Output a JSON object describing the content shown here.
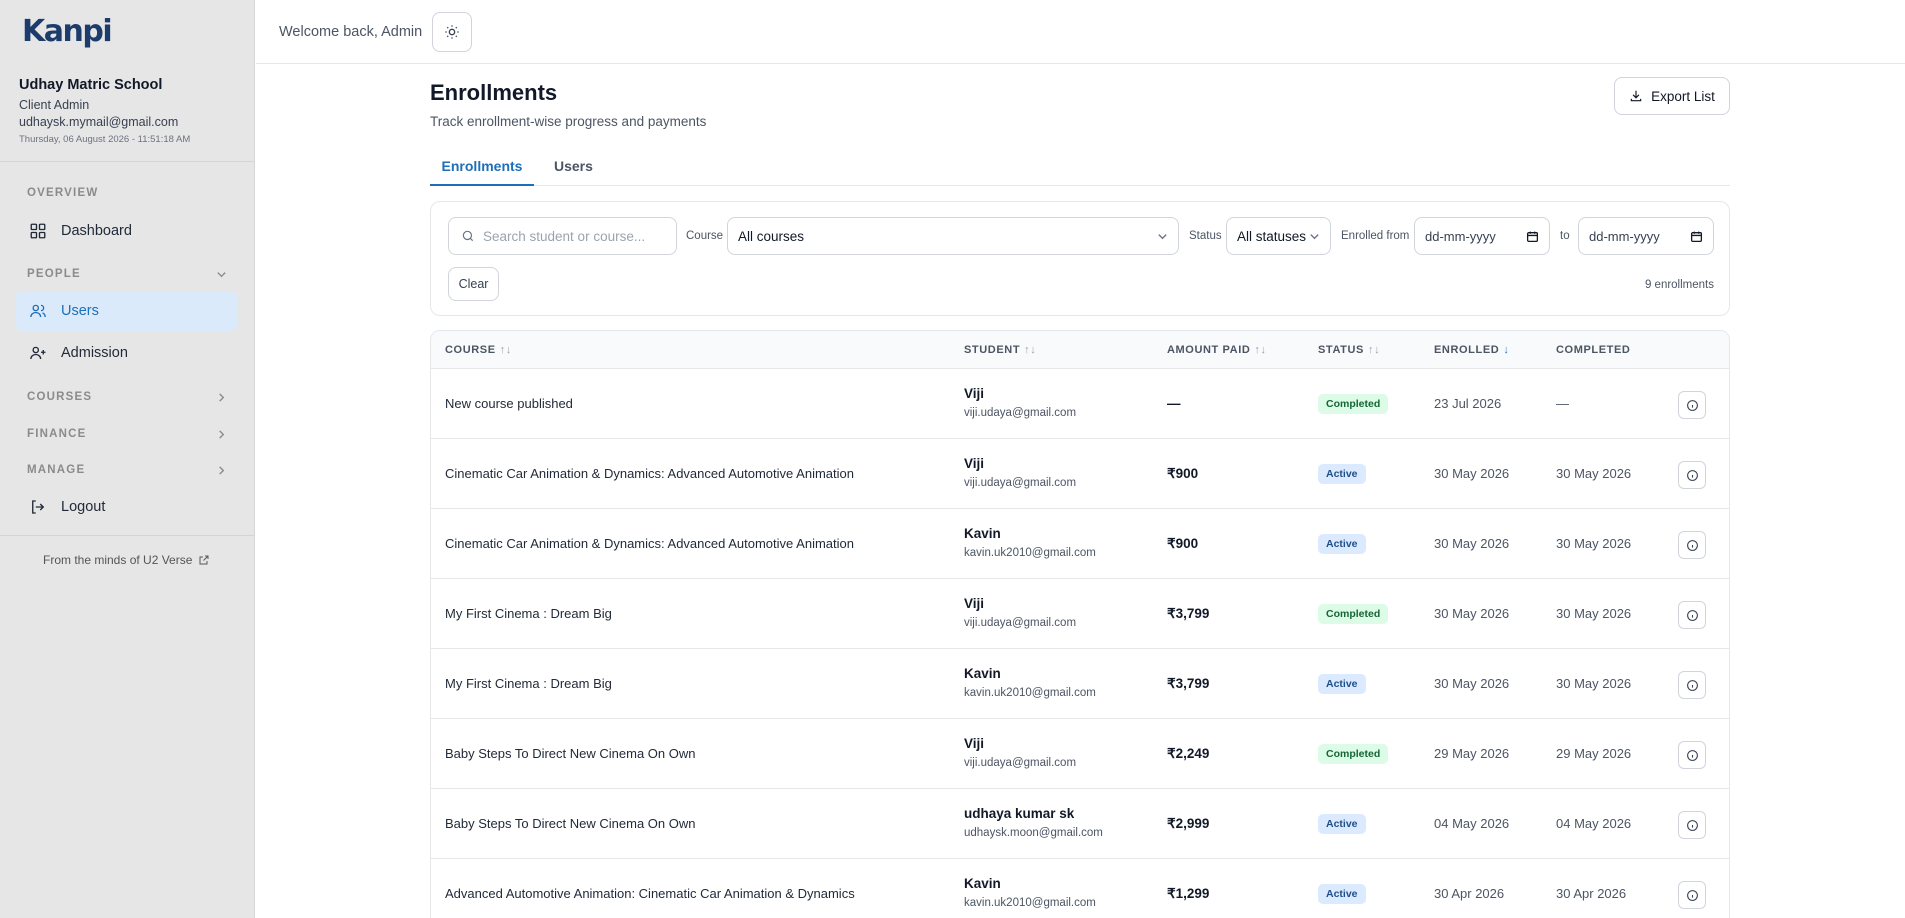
{
  "sidebar": {
    "logo": "Kanpi",
    "org": {
      "name": "Udhay Matric School",
      "role": "Client Admin",
      "email": "udhaysk.mymail@gmail.com",
      "datetime": "Thursday, 06 August 2026 - 11:51:18 AM"
    },
    "sections": {
      "overview": "OVERVIEW",
      "people": "PEOPLE",
      "courses": "COURSES",
      "finance": "FINANCE",
      "manage": "MANAGE"
    },
    "items": {
      "dashboard": "Dashboard",
      "users": "Users",
      "admission": "Admission",
      "logout": "Logout"
    },
    "footer": "From the minds of U2 Verse"
  },
  "topbar": {
    "welcome": "Welcome back, Admin"
  },
  "page": {
    "title": "Enrollments",
    "subtitle": "Track enrollment-wise progress and payments",
    "export_label": "Export List",
    "tabs": [
      "Enrollments",
      "Users"
    ]
  },
  "filters": {
    "search_placeholder": "Search student or course...",
    "course_label": "Course",
    "course_value": "All courses",
    "status_label": "Status",
    "status_value": "All statuses",
    "enrolled_from_label": "Enrolled from",
    "date_from": "dd-mm-yyyy",
    "to_label": "to",
    "date_to": "dd-mm-yyyy",
    "clear_label": "Clear",
    "count": "9 enrollments"
  },
  "table": {
    "headers": {
      "course": "COURSE",
      "student": "STUDENT",
      "amount": "AMOUNT PAID",
      "status": "STATUS",
      "enrolled": "ENROLLED",
      "completed": "COMPLETED"
    },
    "rows": [
      {
        "course": "New course published",
        "name": "Viji",
        "email": "viji.udaya@gmail.com",
        "amount": "—",
        "status": "Completed",
        "enrolled": "23 Jul 2026",
        "completed": "—"
      },
      {
        "course": "Cinematic Car Animation & Dynamics: Advanced Automotive Animation",
        "name": "Viji",
        "email": "viji.udaya@gmail.com",
        "amount": "₹900",
        "status": "Active",
        "enrolled": "30 May 2026",
        "completed": "30 May 2026"
      },
      {
        "course": "Cinematic Car Animation & Dynamics: Advanced Automotive Animation",
        "name": "Kavin",
        "email": "kavin.uk2010@gmail.com",
        "amount": "₹900",
        "status": "Active",
        "enrolled": "30 May 2026",
        "completed": "30 May 2026"
      },
      {
        "course": "My First Cinema : Dream Big",
        "name": "Viji",
        "email": "viji.udaya@gmail.com",
        "amount": "₹3,799",
        "status": "Completed",
        "enrolled": "30 May 2026",
        "completed": "30 May 2026"
      },
      {
        "course": "My First Cinema : Dream Big",
        "name": "Kavin",
        "email": "kavin.uk2010@gmail.com",
        "amount": "₹3,799",
        "status": "Active",
        "enrolled": "30 May 2026",
        "completed": "30 May 2026"
      },
      {
        "course": "Baby Steps To Direct New Cinema On Own",
        "name": "Viji",
        "email": "viji.udaya@gmail.com",
        "amount": "₹2,249",
        "status": "Completed",
        "enrolled": "29 May 2026",
        "completed": "29 May 2026"
      },
      {
        "course": "Baby Steps To Direct New Cinema On Own",
        "name": "udhaya kumar sk",
        "email": "udhaysk.moon@gmail.com",
        "amount": "₹2,999",
        "status": "Active",
        "enrolled": "04 May 2026",
        "completed": "04 May 2026"
      },
      {
        "course": "Advanced Automotive Animation: Cinematic Car Animation & Dynamics",
        "name": "Kavin",
        "email": "kavin.uk2010@gmail.com",
        "amount": "₹1,299",
        "status": "Active",
        "enrolled": "30 Apr 2026",
        "completed": "30 Apr 2026"
      }
    ]
  },
  "colors": {
    "accent": "#1d6fb8",
    "completed_bg": "#dcfce7",
    "active_bg": "#dbeafe"
  }
}
